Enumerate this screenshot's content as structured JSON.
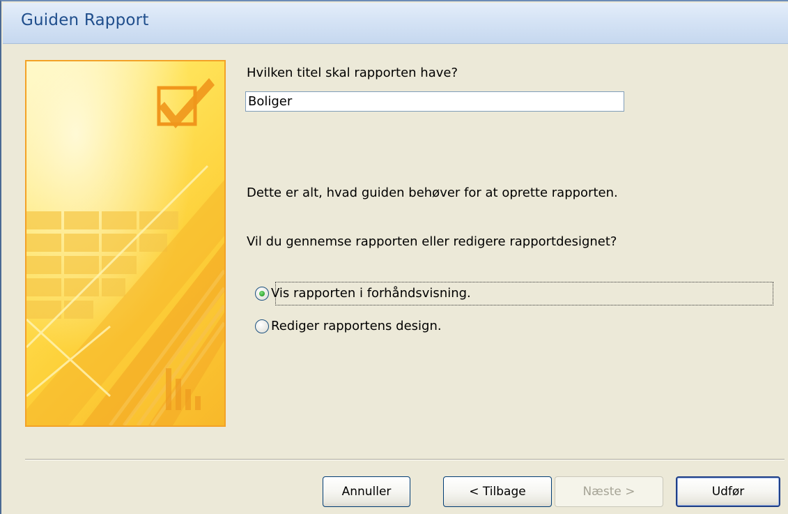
{
  "window": {
    "title": "Guiden Rapport"
  },
  "form": {
    "title_question": "Hvilken titel skal rapporten have?",
    "title_value": "Boliger",
    "info_text": "Dette er alt, hvad guiden behøver for at oprette rapporten.",
    "next_question": "Vil du gennemse rapporten eller redigere rapportdesignet?",
    "options": [
      {
        "label": "Vis rapporten i forhåndsvisning.",
        "checked": true
      },
      {
        "label": "Rediger rapportens design.",
        "checked": false
      }
    ]
  },
  "buttons": {
    "cancel": "Annuller",
    "back": "< Tilbage",
    "next": "Næste >",
    "finish": "Udfør"
  },
  "colors": {
    "title_text": "#1f4e8c",
    "banner_border": "#f3a227",
    "banner_fill": "#fdd13a"
  }
}
